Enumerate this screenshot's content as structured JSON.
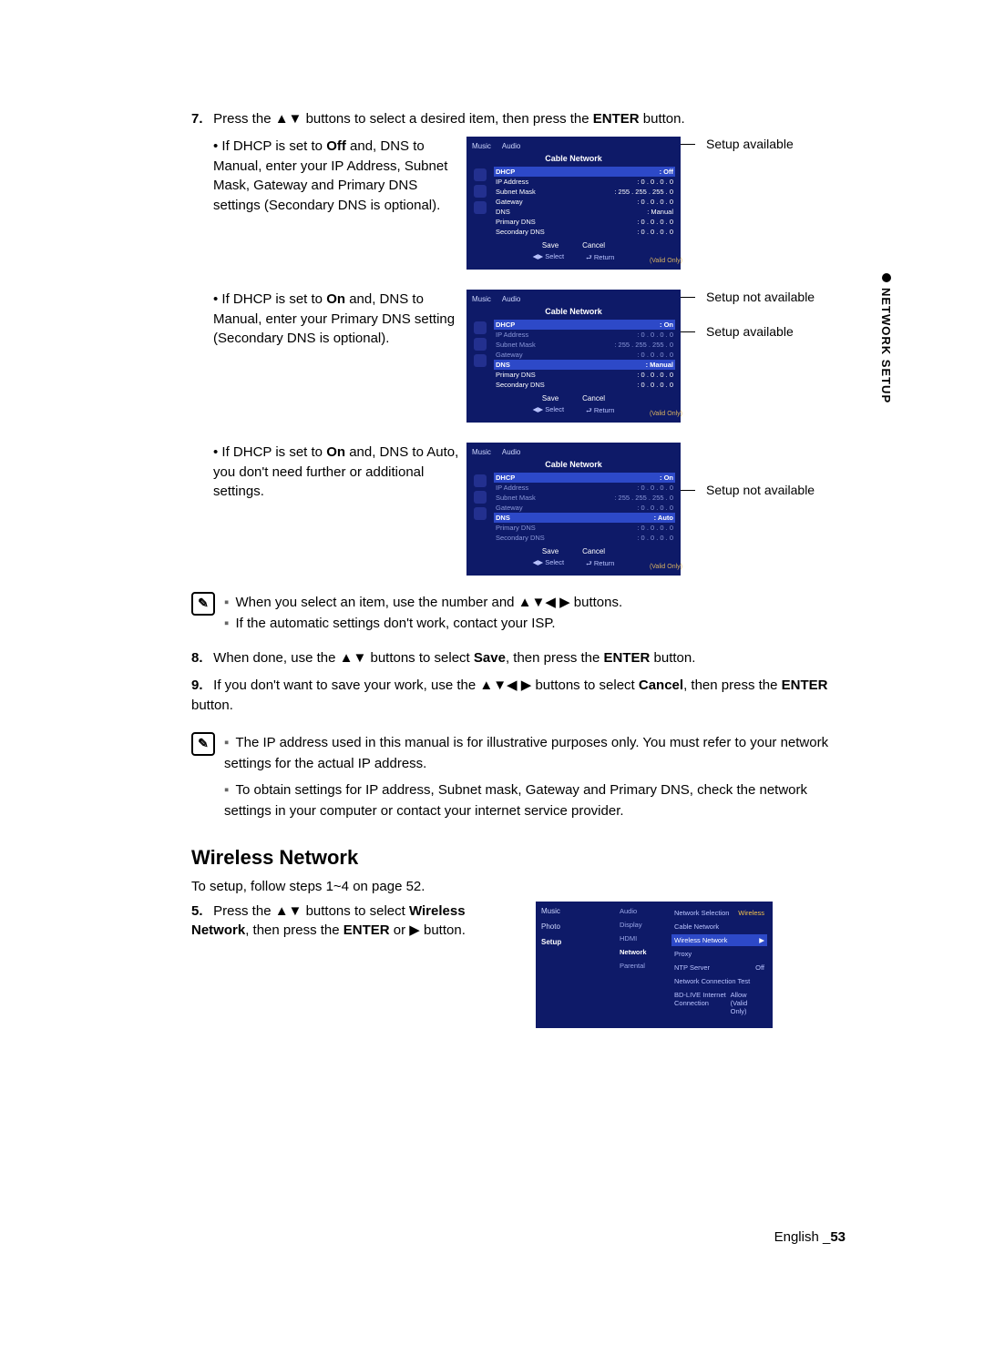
{
  "step7": {
    "num": "7.",
    "text_a": "Press the ",
    "text_b": " buttons to select a desired item, then press the ",
    "text_c": " button.",
    "arrows": "▲▼",
    "enter": "ENTER"
  },
  "bullet1": {
    "text_a": "If DHCP is set to ",
    "off": "Off",
    "text_b": " and, DNS to Manual, enter your IP Address, Subnet Mask, Gateway and Primary DNS settings (Secondary DNS is optional).",
    "annot1": "Setup available"
  },
  "bullet2": {
    "text_a": "If DHCP is set to ",
    "on": "On",
    "text_b": " and, DNS to Manual, enter your Primary DNS setting (Secondary DNS is optional).",
    "annot1": "Setup not available",
    "annot2": "Setup available"
  },
  "bullet3": {
    "text_a": "If DHCP is set to ",
    "on": "On",
    "text_b": " and, DNS to Auto, you don't need further or additional settings.",
    "annot1": "Setup not available"
  },
  "ss_common": {
    "top1": "Music",
    "top2": "Audio",
    "header": "Cable Network",
    "foot_select": "◀▶ Select",
    "foot_return": "⮐ Return",
    "action_save": "Save",
    "action_cancel": "Cancel",
    "tag": "(Valid Only)"
  },
  "ss1": {
    "rows": [
      {
        "k": "DHCP",
        "v": ": Off",
        "hl": true
      },
      {
        "k": "IP Address",
        "v": ": 0 . 0 . 0 . 0"
      },
      {
        "k": "Subnet Mask",
        "v": ": 255 . 255 . 255 . 0"
      },
      {
        "k": "Gateway",
        "v": ": 0 . 0 . 0 . 0"
      },
      {
        "k": "DNS",
        "v": ": Manual"
      },
      {
        "k": "Primary DNS",
        "v": ": 0 . 0 . 0 . 0"
      },
      {
        "k": "Secondary DNS",
        "v": ": 0 . 0 . 0 . 0"
      }
    ]
  },
  "ss2": {
    "rows": [
      {
        "k": "DHCP",
        "v": ": On",
        "hl": true
      },
      {
        "k": "IP Address",
        "v": ": 0 . 0 . 0 . 0",
        "dim": true
      },
      {
        "k": "Subnet Mask",
        "v": ": 255 . 255 . 255 . 0",
        "dim": true
      },
      {
        "k": "Gateway",
        "v": ": 0 . 0 . 0 . 0",
        "dim": true
      },
      {
        "k": "DNS",
        "v": ": Manual",
        "hl": true
      },
      {
        "k": "Primary DNS",
        "v": ": 0 . 0 . 0 . 0"
      },
      {
        "k": "Secondary DNS",
        "v": ": 0 . 0 . 0 . 0"
      }
    ]
  },
  "ss3": {
    "rows": [
      {
        "k": "DHCP",
        "v": ": On",
        "hl": true
      },
      {
        "k": "IP Address",
        "v": ": 0 . 0 . 0 . 0",
        "dim": true
      },
      {
        "k": "Subnet Mask",
        "v": ": 255 . 255 . 255 . 0",
        "dim": true
      },
      {
        "k": "Gateway",
        "v": ": 0 . 0 . 0 . 0",
        "dim": true
      },
      {
        "k": "DNS",
        "v": ": Auto",
        "hl": true
      },
      {
        "k": "Primary DNS",
        "v": ": 0 . 0 . 0 . 0",
        "dim": true
      },
      {
        "k": "Secondary DNS",
        "v": ": 0 . 0 . 0 . 0",
        "dim": true
      }
    ]
  },
  "note1": {
    "item1": "When you select an item, use the number and ▲▼◀ ▶ buttons.",
    "item2": "If the automatic settings don't work, contact your ISP."
  },
  "step8": {
    "num": "8.",
    "text_a": "When done, use the ",
    "arrows": "▲▼",
    "text_b": " buttons to select ",
    "save": "Save",
    "text_c": ", then press the ",
    "enter": "ENTER",
    "text_d": " button."
  },
  "step9": {
    "num": "9.",
    "text_a": "If you don't want to save your work, use the ",
    "arrows": "▲▼◀ ▶",
    "text_b": " buttons to select ",
    "cancel": "Cancel",
    "text_c": ", then press the ",
    "enter": "ENTER",
    "text_d": " button."
  },
  "note2": {
    "item1": "The IP address used in this manual is for illustrative purposes only. You must refer to your network settings for the actual IP address.",
    "item2": "To obtain settings for IP address, Subnet mask, Gateway and Primary DNS, check the network settings in your computer or contact your internet service provider."
  },
  "wireless": {
    "heading": "Wireless Network",
    "intro": "To setup, follow steps 1~4 on page 52."
  },
  "step5": {
    "num": "5.",
    "text_a": "Press the ",
    "arrows": "▲▼",
    "text_b": " buttons to select ",
    "wn": "Wireless Network",
    "text_c": ", then press the ",
    "enter": "ENTER",
    "text_d": " or ▶ button."
  },
  "ss_menu": {
    "left": [
      "Music",
      "Photo",
      "Setup"
    ],
    "mid": [
      "Audio",
      "Display",
      "HDMI",
      "Network",
      "Parental"
    ],
    "right": [
      {
        "k": "Network Selection",
        "v": "Wireless",
        "sel": true
      },
      {
        "k": "Cable Network",
        "v": ""
      },
      {
        "k": "Wireless Network",
        "v": "▶",
        "hl": true
      },
      {
        "k": "Proxy",
        "v": ""
      },
      {
        "k": "NTP Server",
        "v": "Off"
      },
      {
        "k": "Network Connection Test",
        "v": ""
      },
      {
        "k": "BD-LIVE Internet Connection",
        "v": "Allow (Valid Only)"
      }
    ]
  },
  "side": {
    "label": "NETWORK SETUP"
  },
  "footer": {
    "lang": "English",
    "sep": "_",
    "page": "53"
  }
}
